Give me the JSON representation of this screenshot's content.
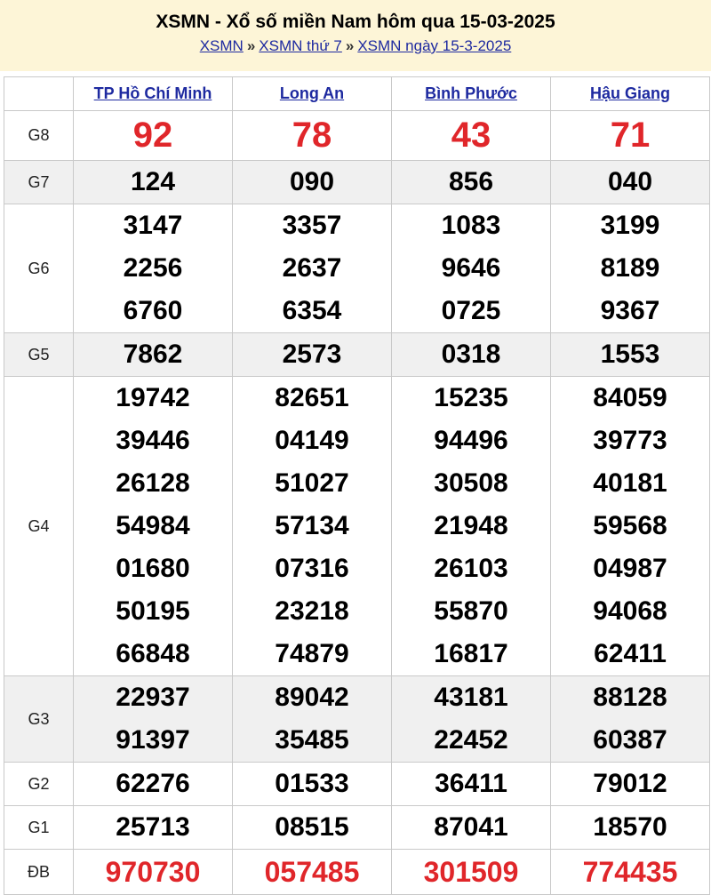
{
  "header": {
    "title": "XSMN - Xổ số miền Nam hôm qua 15-03-2025",
    "breadcrumb": [
      "XSMN",
      "XSMN thứ 7",
      "XSMN ngày 15-3-2025"
    ],
    "separator": "»"
  },
  "provinces": [
    "TP Hồ Chí Minh",
    "Long An",
    "Bình Phước",
    "Hậu Giang"
  ],
  "prizes": {
    "g8": {
      "label": "G8",
      "values": [
        [
          "92"
        ],
        [
          "78"
        ],
        [
          "43"
        ],
        [
          "71"
        ]
      ]
    },
    "g7": {
      "label": "G7",
      "values": [
        [
          "124"
        ],
        [
          "090"
        ],
        [
          "856"
        ],
        [
          "040"
        ]
      ]
    },
    "g6": {
      "label": "G6",
      "values": [
        [
          "3147",
          "2256",
          "6760"
        ],
        [
          "3357",
          "2637",
          "6354"
        ],
        [
          "1083",
          "9646",
          "0725"
        ],
        [
          "3199",
          "8189",
          "9367"
        ]
      ]
    },
    "g5": {
      "label": "G5",
      "values": [
        [
          "7862"
        ],
        [
          "2573"
        ],
        [
          "0318"
        ],
        [
          "1553"
        ]
      ]
    },
    "g4": {
      "label": "G4",
      "values": [
        [
          "19742",
          "39446",
          "26128",
          "54984",
          "01680",
          "50195",
          "66848"
        ],
        [
          "82651",
          "04149",
          "51027",
          "57134",
          "07316",
          "23218",
          "74879"
        ],
        [
          "15235",
          "94496",
          "30508",
          "21948",
          "26103",
          "55870",
          "16817"
        ],
        [
          "84059",
          "39773",
          "40181",
          "59568",
          "04987",
          "94068",
          "62411"
        ]
      ]
    },
    "g3": {
      "label": "G3",
      "values": [
        [
          "22937",
          "91397"
        ],
        [
          "89042",
          "35485"
        ],
        [
          "43181",
          "22452"
        ],
        [
          "88128",
          "60387"
        ]
      ]
    },
    "g2": {
      "label": "G2",
      "values": [
        [
          "62276"
        ],
        [
          "01533"
        ],
        [
          "36411"
        ],
        [
          "79012"
        ]
      ]
    },
    "g1": {
      "label": "G1",
      "values": [
        [
          "25713"
        ],
        [
          "08515"
        ],
        [
          "87041"
        ],
        [
          "18570"
        ]
      ]
    },
    "db": {
      "label": "ĐB",
      "values": [
        [
          "970730"
        ],
        [
          "057485"
        ],
        [
          "301509"
        ],
        [
          "774435"
        ]
      ]
    }
  },
  "colors": {
    "header_bg": "#fdf5d7",
    "link": "#1e2aa0",
    "highlight_red": "#e0262a",
    "alt_row_bg": "#f0f0f0",
    "border": "#c9c9c9"
  }
}
